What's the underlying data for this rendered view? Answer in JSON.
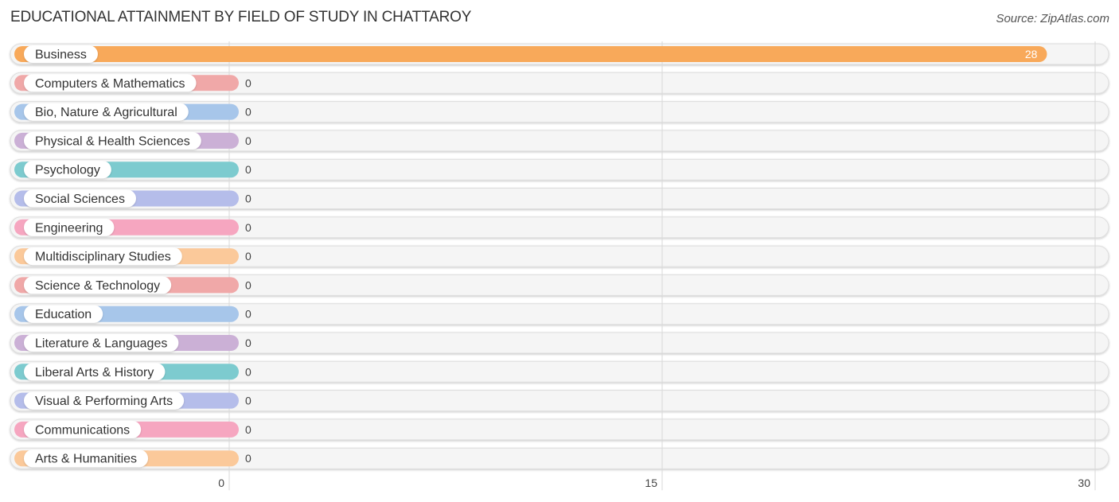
{
  "header": {
    "title": "EDUCATIONAL ATTAINMENT BY FIELD OF STUDY IN CHATTAROY",
    "source": "Source: ZipAtlas.com"
  },
  "chart_data": {
    "type": "bar",
    "orientation": "horizontal",
    "title": "EDUCATIONAL ATTAINMENT BY FIELD OF STUDY IN CHATTAROY",
    "xlabel": "",
    "ylabel": "",
    "xlim": [
      0,
      30
    ],
    "xticks": [
      0,
      15,
      30
    ],
    "grid": true,
    "legend": "none",
    "categories": [
      "Business",
      "Computers & Mathematics",
      "Bio, Nature & Agricultural",
      "Physical & Health Sciences",
      "Psychology",
      "Social Sciences",
      "Engineering",
      "Multidisciplinary Studies",
      "Science & Technology",
      "Education",
      "Literature & Languages",
      "Liberal Arts & History",
      "Visual & Performing Arts",
      "Communications",
      "Arts & Humanities"
    ],
    "values": [
      28,
      0,
      0,
      0,
      0,
      0,
      0,
      0,
      0,
      0,
      0,
      0,
      0,
      0,
      0
    ],
    "colors": [
      "#f8a95a",
      "#f0a8a8",
      "#a7c6ea",
      "#cbb0d6",
      "#7dcbcf",
      "#b5bdea",
      "#f6a6c0",
      "#fbc99a",
      "#f0a8a8",
      "#a7c6ea",
      "#cbb0d6",
      "#7dcbcf",
      "#b5bdea",
      "#f6a6c0",
      "#fbc99a"
    ]
  }
}
